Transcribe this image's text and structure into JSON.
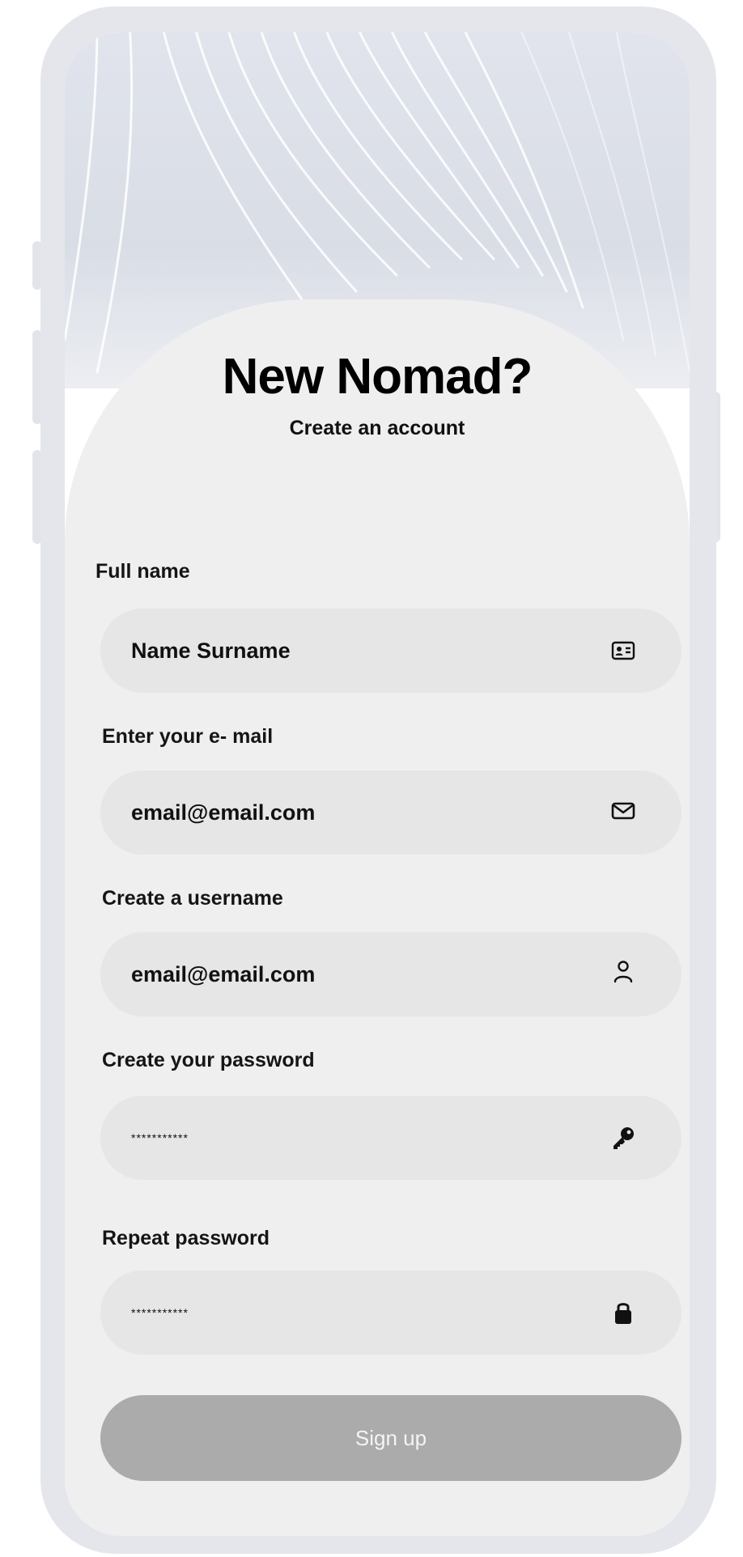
{
  "signup": {
    "title": "New Nomad?",
    "subtitle": "Create an account",
    "fields": [
      {
        "label": "Full name",
        "value": "Name Surname",
        "icon": "id-card-icon"
      },
      {
        "label": "Enter your e- mail",
        "value": "email@email.com",
        "icon": "envelope-icon"
      },
      {
        "label": "Create a username",
        "value": "email@email.com",
        "icon": "user-icon"
      },
      {
        "label": "Create your password",
        "value": "***********",
        "icon": "key-icon"
      },
      {
        "label": "Repeat password",
        "value": "***********",
        "icon": "lock-icon"
      }
    ],
    "button_label": "Sign up"
  },
  "colors": {
    "background": "#efefef",
    "field": "#e6e6e6",
    "button": "#ababab",
    "frame": "#e4e6ec"
  }
}
